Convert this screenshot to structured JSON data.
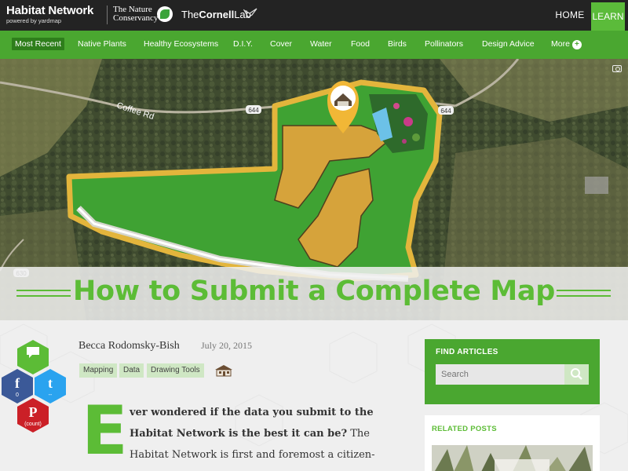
{
  "header": {
    "brand_title": "Habitat Network",
    "brand_sub": "powered by yardmap",
    "partner1_line1": "The Nature",
    "partner1_line2": "Conservancy",
    "partner2_prefix": "The",
    "partner2_bold": "Cornell",
    "partner2_suffix": "Lab",
    "nav_home": "HOME",
    "nav_learn": "LEARN"
  },
  "categories": [
    "Most Recent",
    "Native Plants",
    "Healthy Ecosystems",
    "D.I.Y.",
    "Cover",
    "Water",
    "Food",
    "Birds",
    "Pollinators",
    "Design Advice",
    "More"
  ],
  "hero": {
    "road_label": "Coffee Rd",
    "route_a": "644",
    "route_b": "644",
    "route_c": "630",
    "title": "How to Submit a Complete Map"
  },
  "article": {
    "author": "Becca Rodomsky-Bish",
    "date": "July 20, 2015",
    "tags": [
      "Mapping",
      "Data",
      "Drawing Tools"
    ],
    "dropcap": "E",
    "line1": "ver wondered if the data you submit to the",
    "line2_bold": "Habitat Network is the best it can be?",
    "line2_rest": " The",
    "line3": "Habitat Network is first and foremost a citizen-"
  },
  "share": {
    "facebook_count": "0",
    "twitter_count": "--",
    "pinterest_count": "(count)"
  },
  "sidebar": {
    "find_header": "FIND ARTICLES",
    "search_placeholder": "Search",
    "related_header": "RELATED POSTS"
  },
  "colors": {
    "accent": "#5cbc36",
    "nav_green": "#4aa730",
    "topbar": "#232323",
    "facebook": "#3b5998",
    "twitter": "#2aa3ef",
    "pinterest": "#cb2027"
  }
}
